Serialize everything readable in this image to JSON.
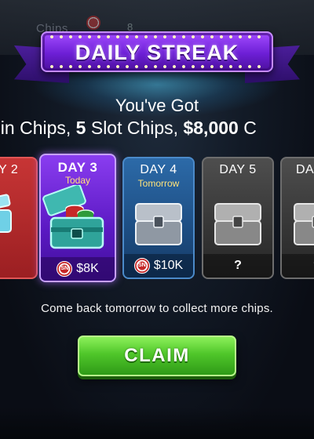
{
  "background": {
    "label": "Chips",
    "number": "8"
  },
  "banner": {
    "title": "DAILY STREAK"
  },
  "headline": "You've Got",
  "subline": {
    "a": "oin Chips, ",
    "b": "5",
    "c": " Slot Chips, ",
    "d": "$8,000",
    "e": " C"
  },
  "cards": {
    "d2": {
      "day": "Y 2"
    },
    "d3": {
      "day": "DAY 3",
      "sub": "Today",
      "reward": "$8K"
    },
    "d4": {
      "day": "DAY 4",
      "sub": "Tomorrow",
      "reward": "$10K"
    },
    "d5": {
      "day": "DAY 5",
      "reward": "?"
    },
    "d6": {
      "day": "DA",
      "reward": "?"
    }
  },
  "message": "Come back tomorrow to collect more chips.",
  "claim_label": "CLAIM",
  "colors": {
    "banner": "#7a27e6",
    "today_card": "#6a22d6",
    "tomorrow_card": "#2a5f98",
    "locked_card": "#3a3a3a",
    "claimed_card": "#b82b2e",
    "claim_button": "#4fc62a"
  }
}
